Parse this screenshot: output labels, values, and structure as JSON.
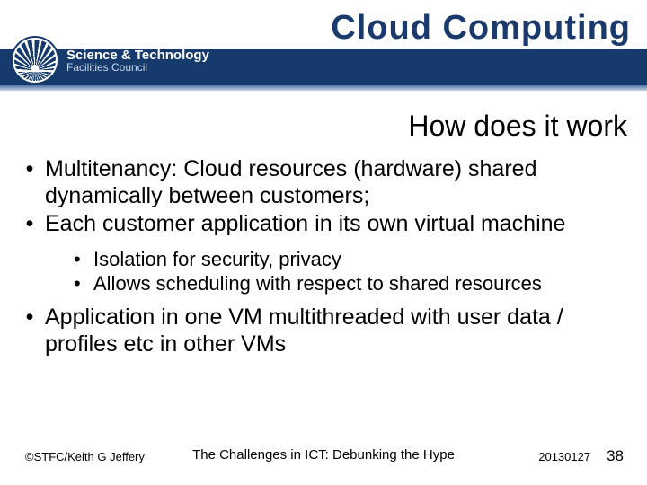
{
  "header": {
    "title": "Cloud Computing",
    "org_line1": "Science & Technology",
    "org_line2": "Facilities Council"
  },
  "subtitle": "How does it work",
  "bullets": {
    "b1": "Multitenancy: Cloud resources (hardware) shared dynamically between customers;",
    "b2": "Each customer application in its own virtual machine",
    "s1": "Isolation for security, privacy",
    "s2": "Allows scheduling with respect to shared resources",
    "b3": "Application in one VM multithreaded with user data / profiles etc in other VMs"
  },
  "footer": {
    "copyright": "©STFC/Keith G Jeffery",
    "center": "The Challenges in ICT: Debunking the Hype",
    "date": "20130127",
    "slide_number": "38"
  }
}
